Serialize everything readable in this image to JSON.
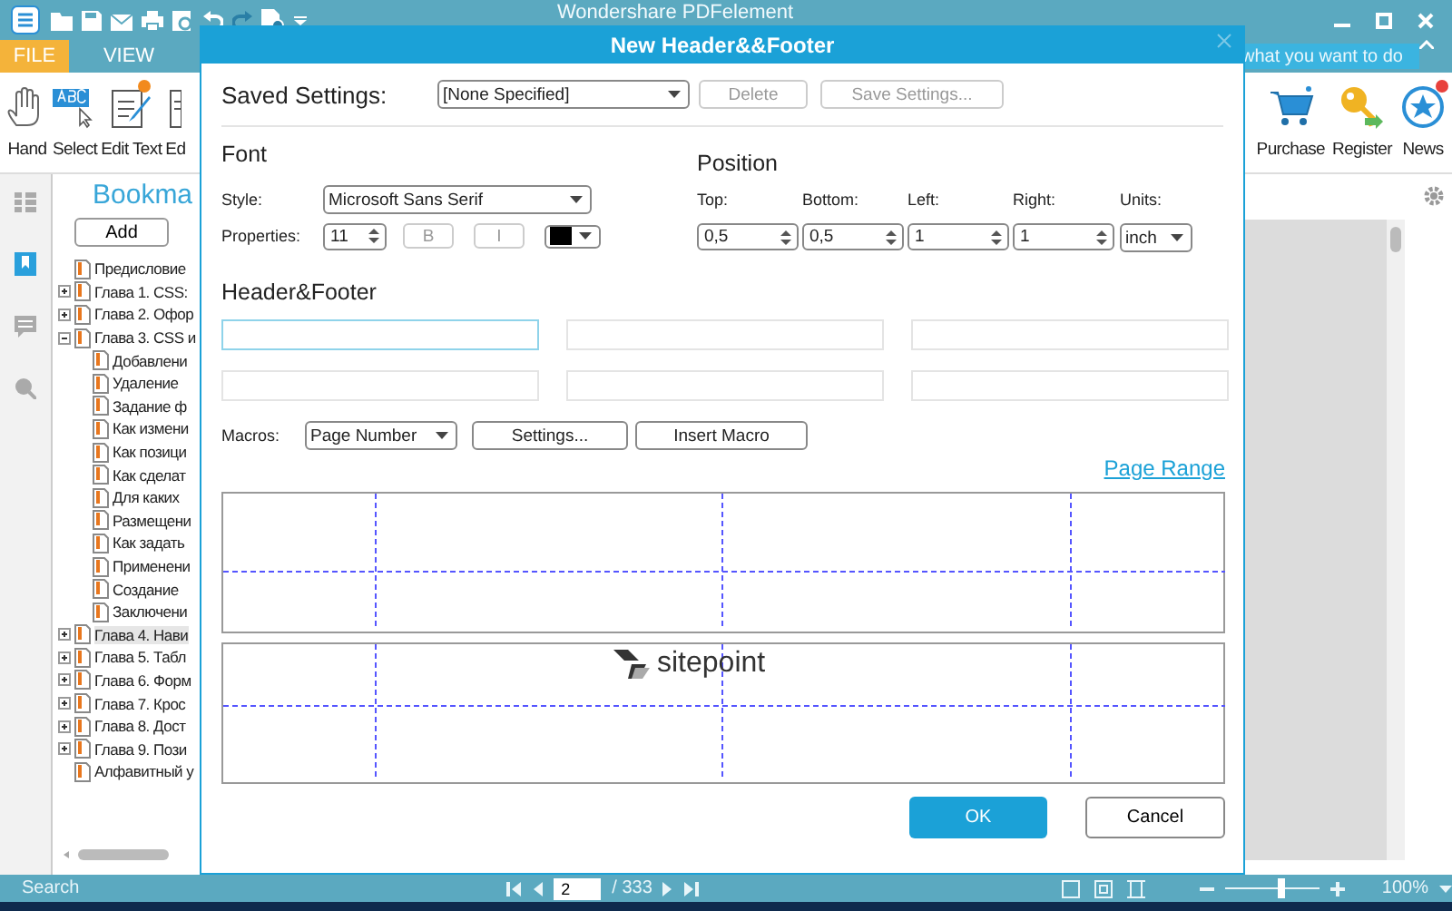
{
  "app": {
    "title": "Wondershare PDFelement",
    "menu_tabs": [
      {
        "label": "FILE",
        "selected": true
      },
      {
        "label": "VIEW",
        "selected": false
      }
    ],
    "tell_me": {
      "placeholder": "what you want to do"
    },
    "ribbon_tools": [
      {
        "label": "Hand",
        "kind": "hand"
      },
      {
        "label": "Select",
        "kind": "select"
      },
      {
        "label": "Edit Text",
        "kind": "edit",
        "badge": true
      },
      {
        "label": "Ed",
        "kind": "partial",
        "badge": false
      }
    ],
    "right_tools": [
      {
        "label": "Purchase",
        "kind": "cart",
        "badge": false
      },
      {
        "label": "Register",
        "kind": "key",
        "badge": false
      },
      {
        "label": "News",
        "kind": "star",
        "badge": true
      }
    ]
  },
  "sidebar": {
    "title": "Bookma",
    "add_button": "Add",
    "tree": [
      {
        "label": "Предисловие",
        "kind": "page",
        "selected": false
      },
      {
        "label": "Глава 1.  CSS:",
        "kind": "chapter",
        "expanded": false,
        "selected": false
      },
      {
        "label": "Глава 2.  Офор",
        "kind": "chapter",
        "expanded": false,
        "selected": false
      },
      {
        "label": "Глава 3.  CSS и",
        "kind": "chapter",
        "expanded": true,
        "selected": false,
        "children": [
          {
            "label": "Добавлени",
            "selected": false
          },
          {
            "label": "Удаление",
            "selected": false
          },
          {
            "label": "Задание ф",
            "selected": false
          },
          {
            "label": "Как измени",
            "selected": false
          },
          {
            "label": "Как позици",
            "selected": false
          },
          {
            "label": "Как сделат",
            "selected": false
          },
          {
            "label": "Для каких",
            "selected": false
          },
          {
            "label": "Размещени",
            "selected": false
          },
          {
            "label": "Как задать",
            "selected": false
          },
          {
            "label": "Применени",
            "selected": false
          },
          {
            "label": "Создание",
            "selected": false
          },
          {
            "label": "Заключени",
            "selected": false
          }
        ]
      },
      {
        "label": "Глава 4.  Нави",
        "kind": "chapter",
        "expanded": false,
        "selected": true
      },
      {
        "label": "Глава 5.  Табл",
        "kind": "chapter",
        "expanded": false,
        "selected": false
      },
      {
        "label": "Глава 6.  Форм",
        "kind": "chapter",
        "expanded": false,
        "selected": false
      },
      {
        "label": "Глава 7.  Крос",
        "kind": "chapter",
        "expanded": false,
        "selected": false
      },
      {
        "label": "Глава 8.  Дост",
        "kind": "chapter",
        "expanded": false,
        "selected": false
      },
      {
        "label": "Глава 9.  Пози",
        "kind": "chapter",
        "expanded": false,
        "selected": false
      },
      {
        "label": "Алфавитный у",
        "kind": "page",
        "selected": false
      }
    ]
  },
  "dialog": {
    "title": "New Header&&Footer",
    "saved_settings": {
      "label": "Saved Settings:",
      "value": "[None Specified]",
      "buttons": [
        {
          "label": "Delete",
          "disabled": true
        },
        {
          "label": "Save Settings...",
          "disabled": true
        }
      ]
    },
    "font": {
      "heading": "Font",
      "style_label": "Style:",
      "style_value": "Microsoft Sans Serif",
      "properties_label": "Properties:",
      "size": "11",
      "bold": {
        "label": "B",
        "disabled": true
      },
      "italic": {
        "label": "I",
        "disabled": true
      },
      "color": "#000000"
    },
    "position": {
      "heading": "Position",
      "fields": [
        {
          "label": "Top:",
          "value": "0,5"
        },
        {
          "label": "Bottom:",
          "value": "0,5"
        },
        {
          "label": "Left:",
          "value": "1"
        },
        {
          "label": "Right:",
          "value": "1"
        }
      ],
      "units_label": "Units:",
      "units_value": "inch"
    },
    "header_footer": {
      "heading": "Header&Footer",
      "fields": [
        {
          "selected": true
        },
        {
          "selected": false
        },
        {
          "selected": false
        },
        {
          "selected": false
        },
        {
          "selected": false
        },
        {
          "selected": false
        }
      ]
    },
    "macros": {
      "label": "Macros:",
      "value": "Page Number",
      "settings_button": "Settings...",
      "insert_button": "Insert Macro"
    },
    "page_range_link": "Page Range",
    "preview": {
      "logo_text": "sitepoint"
    },
    "ok_button": "OK",
    "cancel_button": "Cancel"
  },
  "status_bar": {
    "search_label": "Search",
    "page": "2",
    "page_total": "/ 333",
    "zoom": {
      "level": 0.58
    },
    "zoom_label": "100%"
  }
}
